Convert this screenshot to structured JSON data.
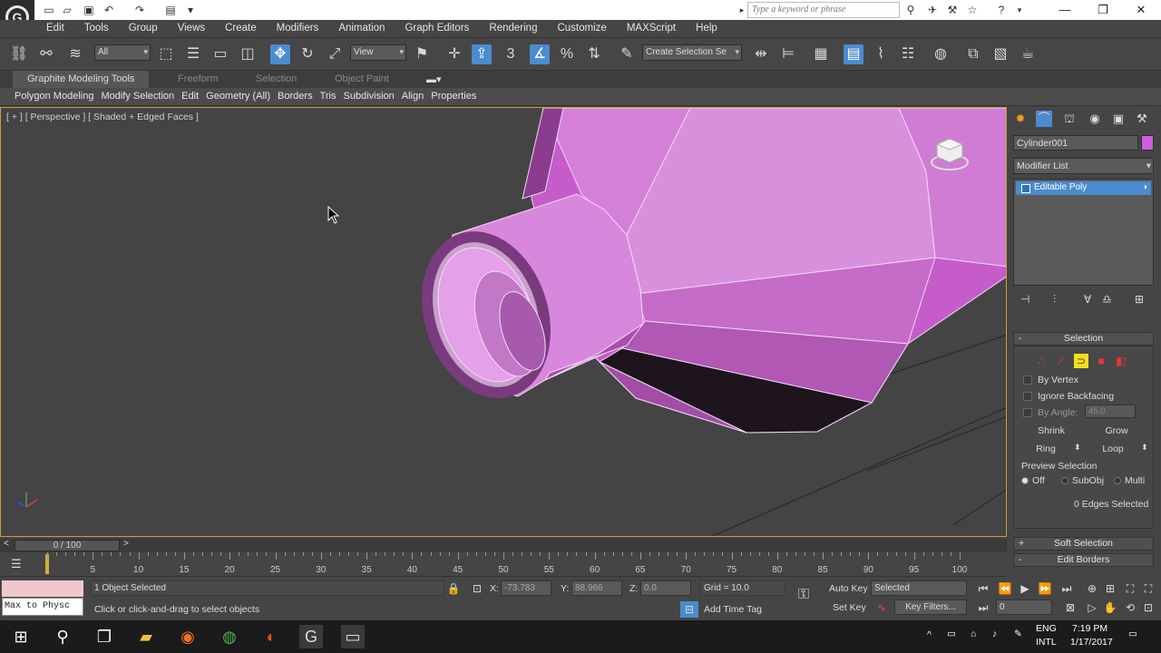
{
  "title_bar": {
    "search_placeholder": "Type a keyword or phrase",
    "app_logo": "G"
  },
  "menu": [
    "Edit",
    "Tools",
    "Group",
    "Views",
    "Create",
    "Modifiers",
    "Animation",
    "Graph Editors",
    "Rendering",
    "Customize",
    "MAXScript",
    "Help"
  ],
  "toolbar": {
    "selection_filter": "All",
    "ref_coord": "View",
    "named_selection": "Create Selection Se",
    "snap_label": "3"
  },
  "ribbon": {
    "tabs": [
      "Graphite Modeling Tools",
      "Freeform",
      "Selection",
      "Object Paint"
    ],
    "panels": [
      "Polygon Modeling",
      "Modify Selection",
      "Edit",
      "Geometry (All)",
      "Borders",
      "Tris",
      "Subdivision",
      "Align",
      "Properties"
    ]
  },
  "viewport": {
    "label": "[ + ] [ Perspective ] [ Shaded + Edged Faces ]"
  },
  "command_panel": {
    "object_name": "Cylinder001",
    "object_color": "#d05ee0",
    "modifier_list": "Modifier List",
    "stack_item": "Editable Poly",
    "selection_rollout": "Selection",
    "by_vertex": "By Vertex",
    "ignore_backfacing": "Ignore Backfacing",
    "by_angle": "By Angle:",
    "angle_value": "45.0",
    "shrink": "Shrink",
    "grow": "Grow",
    "ring": "Ring",
    "loop": "Loop",
    "preview_selection": "Preview Selection",
    "preview_off": "Off",
    "preview_subobj": "SubObj",
    "preview_multi": "Multi",
    "selected_count": "0 Edges Selected",
    "soft_selection": "Soft Selection",
    "edit_borders": "Edit Borders"
  },
  "timeline": {
    "slider_label": "0 / 100",
    "ticks": [
      "5",
      "10",
      "15",
      "20",
      "25",
      "30",
      "35",
      "40",
      "45",
      "50",
      "55",
      "60",
      "65",
      "70",
      "75",
      "80",
      "85",
      "90",
      "95",
      "100"
    ]
  },
  "status": {
    "maxscript": "Max to Physc",
    "objects_selected": "1 Object Selected",
    "prompt": "Click or click-and-drag to select objects",
    "x_label": "X:",
    "x_value": "-73.783",
    "y_label": "Y:",
    "y_value": "88.966",
    "z_label": "Z:",
    "z_value": "0.0",
    "grid": "Grid = 10.0",
    "add_time_tag": "Add Time Tag",
    "auto_key": "Auto Key",
    "set_key": "Set Key",
    "selected_dd": "Selected",
    "key_filters": "Key Filters...",
    "frame_value": "0"
  },
  "taskbar": {
    "lang1": "ENG",
    "lang2": "INTL",
    "time": "7:19 PM",
    "date": "1/17/2017"
  }
}
